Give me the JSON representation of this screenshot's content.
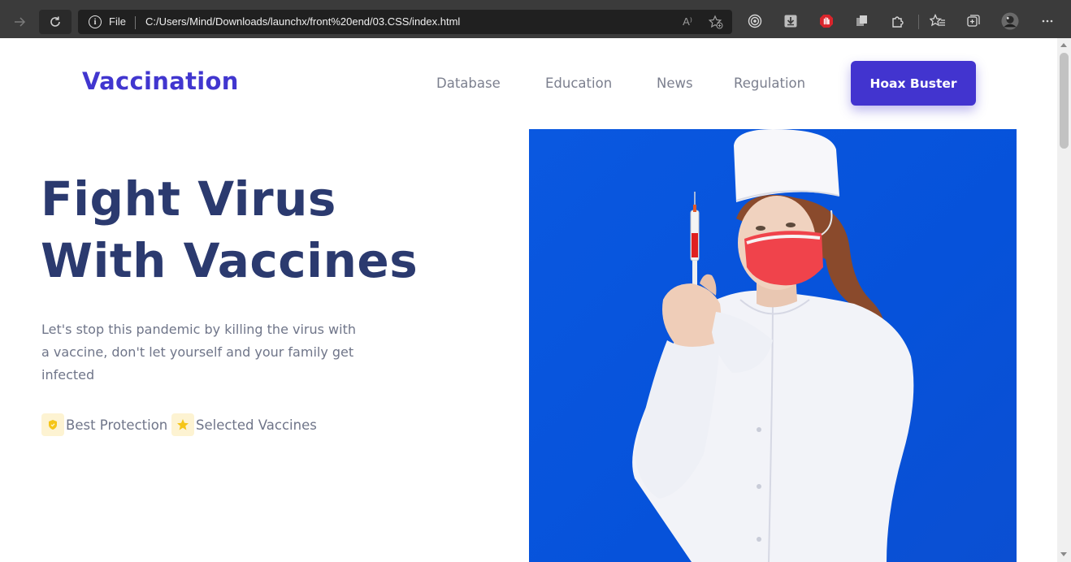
{
  "browser": {
    "protocol_label": "File",
    "url": "C:/Users/Mind/Downloads/launchx/front%20end/03.CSS/index.html",
    "read_aloud_glyph": "A⁾",
    "icons": [
      "back-arrow-icon",
      "reload-icon",
      "info-icon",
      "read-aloud-icon",
      "add-favorite-icon",
      "tracking-prevention-icon",
      "download-icon",
      "adblock-icon",
      "extension-sync-icon",
      "extensions-icon",
      "favorites-icon",
      "collections-icon",
      "profile-avatar",
      "more-menu-icon"
    ]
  },
  "header": {
    "brand": "Vaccination",
    "nav": {
      "database": "Database",
      "education": "Education",
      "news": "News",
      "regulation": "Regulation"
    },
    "cta": "Hoax Buster"
  },
  "hero": {
    "title_line1": "Fight Virus",
    "title_line2": "With Vaccines",
    "description": "Let's stop this pandemic by killing the virus with a vaccine, don't let yourself and your family get infected",
    "features": {
      "protection": "Best Protection",
      "vaccines": "Selected Vaccines"
    },
    "image_description_icon": "nurse-with-syringe-photo"
  },
  "colors": {
    "brand": "#4136cf",
    "cta_bg": "#4234cf",
    "heading": "#2b3a6f",
    "body_text": "#6f7589",
    "hero_bg": "#0652da",
    "feature_icon_bg": "#fdf3d2",
    "feature_icon_fg": "#f5c518"
  }
}
